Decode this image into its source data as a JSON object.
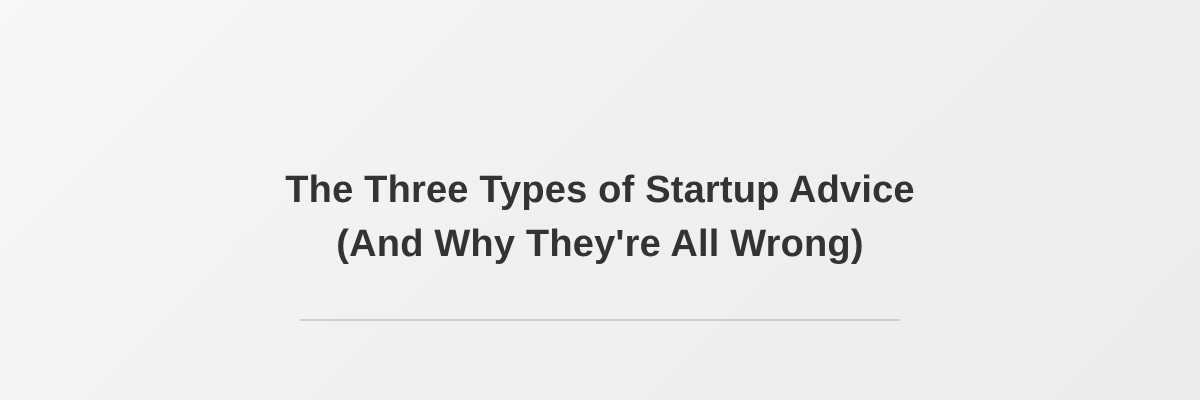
{
  "header": {
    "title_line_1": "The Three Types of Startup Advice",
    "title_line_2": "(And Why They're All Wrong)"
  },
  "colors": {
    "background": "#f0f0f0",
    "title_text": "#333333",
    "divider": "#cfcfcf"
  }
}
